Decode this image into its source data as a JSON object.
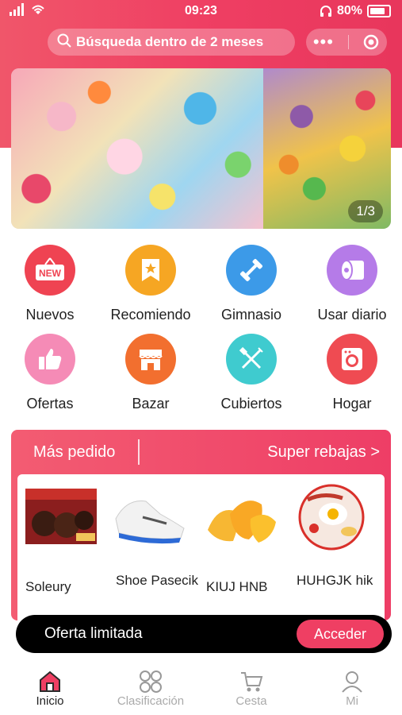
{
  "status_bar": {
    "time": "09:23",
    "battery": "80%"
  },
  "search": {
    "placeholder": "Búsqueda dentro de 2 meses"
  },
  "banner": {
    "counter": "1/3"
  },
  "categories": [
    {
      "label": "Nuevos",
      "color": "#ef4352",
      "icon": "new-sign-icon",
      "badge": "NEW"
    },
    {
      "label": "Recomiendo",
      "color": "#f6a623",
      "icon": "star-bookmark-icon"
    },
    {
      "label": "Gimnasio",
      "color": "#3c9ae8",
      "icon": "dumbbell-icon"
    },
    {
      "label": "Usar diario",
      "color": "#b57be8",
      "icon": "tissue-roll-icon"
    },
    {
      "label": "Ofertas",
      "color": "#f58bb6",
      "icon": "thumbs-up-icon"
    },
    {
      "label": "Bazar",
      "color": "#f26f2f",
      "icon": "shop-icon"
    },
    {
      "label": "Cubiertos",
      "color": "#3fcbcf",
      "icon": "fork-knife-icon"
    },
    {
      "label": "Hogar",
      "color": "#ef4b52",
      "icon": "washing-machine-icon"
    }
  ],
  "promo": {
    "title": "Más pedido",
    "link": "Super rebajas >",
    "products": [
      {
        "name": "Soleury"
      },
      {
        "name": "Shoe Pasecik"
      },
      {
        "name": "KIUJ HNB"
      },
      {
        "name": "HUHGJK hik"
      }
    ]
  },
  "offer_bar": {
    "text": "Oferta limitada",
    "button": "Acceder"
  },
  "tabbar": [
    {
      "label": "Inicio",
      "icon": "home-icon",
      "active": true
    },
    {
      "label": "Clasificación",
      "icon": "grid-icon",
      "active": false
    },
    {
      "label": "Cesta",
      "icon": "cart-icon",
      "active": false
    },
    {
      "label": "Mi",
      "icon": "user-icon",
      "active": false
    }
  ],
  "colors": {
    "accent": "#ef3f63",
    "header": "#f0566a"
  }
}
